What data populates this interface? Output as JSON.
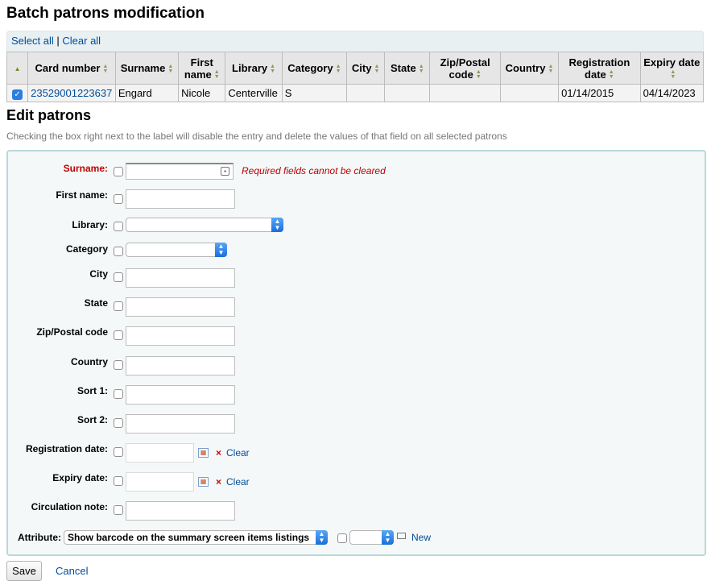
{
  "page": {
    "title": "Batch patrons modification",
    "select_all": "Select all",
    "separator": "|",
    "clear_all": "Clear all"
  },
  "table": {
    "headers": [
      "Card number",
      "Surname",
      "First name",
      "Library",
      "Category",
      "City",
      "State",
      "Zip/Postal code",
      "Country",
      "Registration date",
      "Expiry date"
    ],
    "rows": [
      {
        "checked": true,
        "card_number": "23529001223637",
        "surname": "Engard",
        "first_name": "Nicole",
        "library": "Centerville",
        "category": "S",
        "city": "",
        "state": "",
        "zip": "",
        "country": "",
        "registration_date": "01/14/2015",
        "expiry_date": "04/14/2023"
      }
    ]
  },
  "edit": {
    "title": "Edit patrons",
    "hint": "Checking the box right next to the label will disable the entry and delete the values of that field on all selected patrons",
    "required_message": "Required fields cannot be cleared",
    "fields": {
      "surname": "Surname:",
      "first_name": "First name:",
      "library": "Library:",
      "category": "Category",
      "city": "City",
      "state": "State",
      "zip": "Zip/Postal code",
      "country": "Country",
      "sort1": "Sort 1:",
      "sort2": "Sort 2:",
      "registration_date": "Registration date:",
      "expiry_date": "Expiry date:",
      "circulation_note": "Circulation note:",
      "attribute": "Attribute:"
    },
    "clear_label": "Clear",
    "attribute_value": "Show barcode on the summary screen items listings",
    "new_label": "New"
  },
  "actions": {
    "save": "Save",
    "cancel": "Cancel"
  },
  "colors": {
    "link": "#004d99",
    "required": "#c00000",
    "form_border": "#b9d8d9"
  }
}
